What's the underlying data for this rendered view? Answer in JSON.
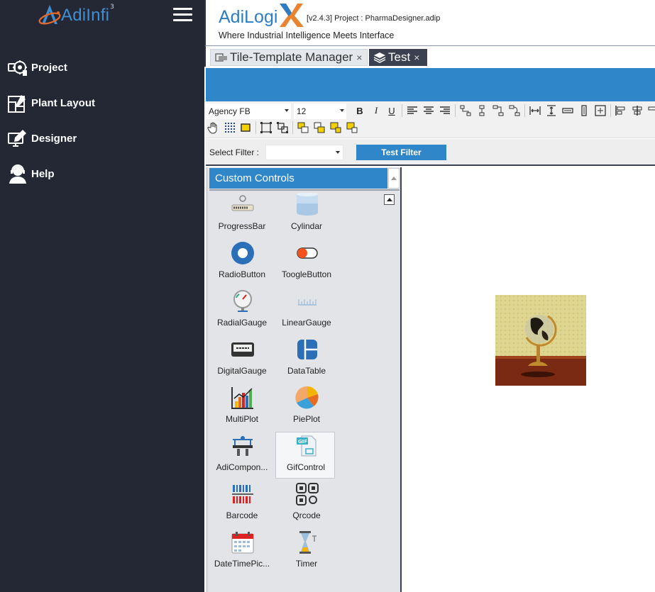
{
  "sidebar": {
    "brand": {
      "text": "AdiInfi",
      "sup": "3"
    },
    "items": [
      {
        "label": "Project",
        "icon": "project-icon"
      },
      {
        "label": "Plant Layout",
        "icon": "plant-layout-icon"
      },
      {
        "label": "Designer",
        "icon": "designer-icon"
      },
      {
        "label": "Help",
        "icon": "help-icon"
      }
    ]
  },
  "header": {
    "app_name": "AdiLogi",
    "app_x": "X",
    "version_project": "[v2.4.3]  Project : PharmaDesigner.adip",
    "tagline": "Where Industrial Intelligence Meets Interface"
  },
  "tabs": [
    {
      "label": "Tile-Template Manager",
      "close": "×",
      "active": false
    },
    {
      "label": "Test",
      "close": "×",
      "active": true
    }
  ],
  "toolbar": {
    "font_family": "Agency FB",
    "font_size": "12",
    "bold": "B",
    "italic": "I",
    "underline": "U"
  },
  "filter": {
    "label": "Select Filter :",
    "value": "",
    "button": "Test Filter"
  },
  "panel": {
    "title": "Custom Controls",
    "controls": [
      {
        "label": "ProgressBar",
        "icon": "progressbar-icon"
      },
      {
        "label": "Cylindar",
        "icon": "cylinder-icon"
      },
      {
        "label": "RadioButton",
        "icon": "radiobutton-icon"
      },
      {
        "label": "ToogleButton",
        "icon": "toggle-icon"
      },
      {
        "label": "RadialGauge",
        "icon": "radial-gauge-icon"
      },
      {
        "label": "LinearGauge",
        "icon": "linear-gauge-icon"
      },
      {
        "label": "DigitalGauge",
        "icon": "digital-gauge-icon"
      },
      {
        "label": "DataTable",
        "icon": "datatable-icon"
      },
      {
        "label": "MultiPlot",
        "icon": "multiplot-icon"
      },
      {
        "label": "PiePlot",
        "icon": "pieplot-icon"
      },
      {
        "label": "AdiCompon...",
        "icon": "adicomponent-icon"
      },
      {
        "label": "GifControl",
        "icon": "gif-icon",
        "selected": true
      },
      {
        "label": "Barcode",
        "icon": "barcode-icon"
      },
      {
        "label": "Qrcode",
        "icon": "qrcode-icon"
      },
      {
        "label": "DateTimePic...",
        "icon": "calendar-icon"
      },
      {
        "label": "Timer",
        "icon": "timer-icon"
      }
    ]
  },
  "canvas": {
    "image": "globe-image"
  },
  "colors": {
    "sidebar": "#232834",
    "accent": "#2f86c8",
    "active_tab": "#3b4150"
  }
}
